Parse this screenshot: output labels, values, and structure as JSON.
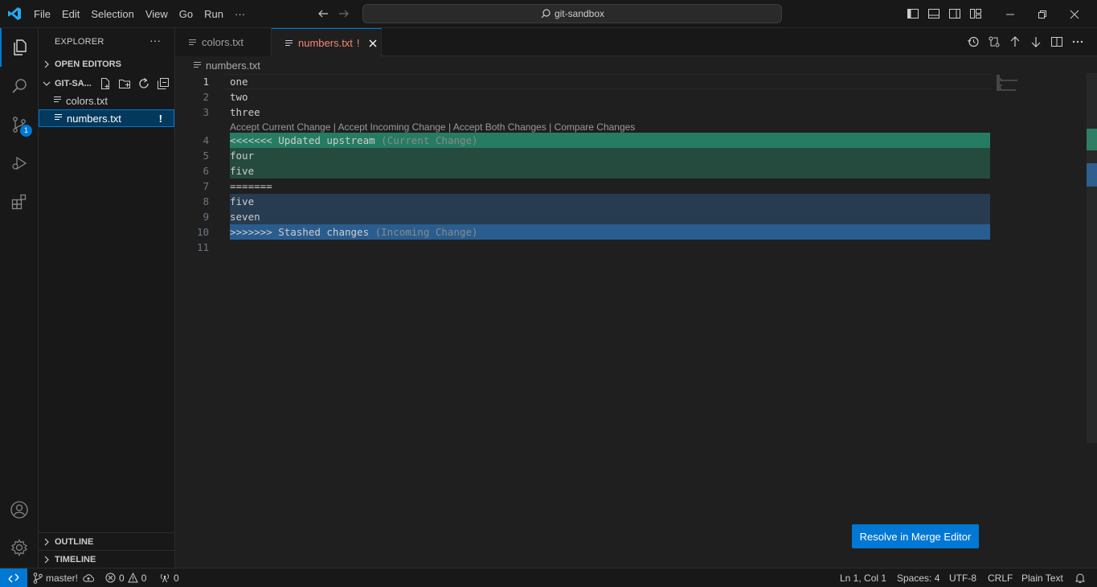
{
  "menu": [
    "File",
    "Edit",
    "Selection",
    "View",
    "Go",
    "Run",
    "···"
  ],
  "search": {
    "text": "git-sandbox"
  },
  "activity": {
    "scm_badge": "1"
  },
  "sidebar": {
    "header": "EXPLORER",
    "more": "···",
    "open_editors": "OPEN EDITORS",
    "folder": "GIT-SA...",
    "files": [
      {
        "name": "colors.txt",
        "status": ""
      },
      {
        "name": "numbers.txt",
        "status": "!"
      }
    ],
    "outline": "OUTLINE",
    "timeline": "TIMELINE"
  },
  "tabs": [
    {
      "label": "colors.txt",
      "status": ""
    },
    {
      "label": "numbers.txt",
      "status": "!"
    }
  ],
  "breadcrumb": "numbers.txt",
  "codelens": "Accept Current Change | Accept Incoming Change | Accept Both Changes | Compare Changes",
  "lines": [
    {
      "num": "1",
      "text": "one",
      "hint": ""
    },
    {
      "num": "2",
      "text": "two",
      "hint": ""
    },
    {
      "num": "3",
      "text": "three",
      "hint": ""
    },
    {
      "num": "4",
      "text": "<<<<<<< Updated upstream",
      "hint": "(Current Change)"
    },
    {
      "num": "5",
      "text": "four",
      "hint": ""
    },
    {
      "num": "6",
      "text": "five",
      "hint": ""
    },
    {
      "num": "7",
      "text": "=======",
      "hint": ""
    },
    {
      "num": "8",
      "text": "five",
      "hint": ""
    },
    {
      "num": "9",
      "text": "seven",
      "hint": ""
    },
    {
      "num": "10",
      "text": ">>>>>>> Stashed changes",
      "hint": "(Incoming Change)"
    },
    {
      "num": "11",
      "text": "",
      "hint": ""
    }
  ],
  "resolve_button": "Resolve in Merge Editor",
  "status": {
    "branch": "master!",
    "errors": "0",
    "warnings": "0",
    "ports": "0",
    "position": "Ln 1, Col 1",
    "spaces": "Spaces: 4",
    "encoding": "UTF-8",
    "eol": "CRLF",
    "language": "Plain Text"
  },
  "colors": {
    "accent": "#0078d4",
    "current_change_header": "#267c63",
    "current_change": "#254a3e",
    "incoming_change": "#273b51",
    "incoming_change_header": "#2a5d8f",
    "conflict_text": "#f48771"
  }
}
